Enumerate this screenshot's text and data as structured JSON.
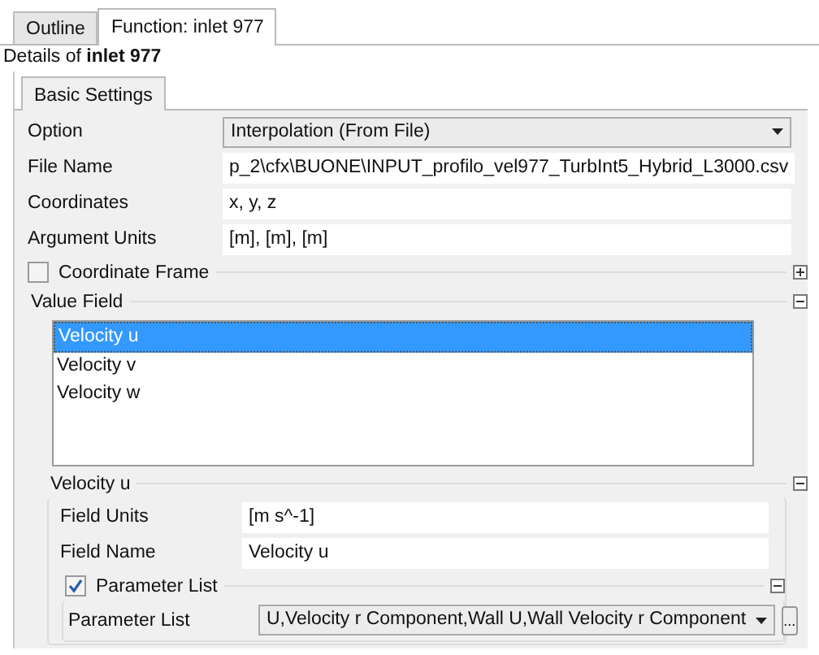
{
  "tabs": [
    {
      "label": "Outline",
      "selected": false
    },
    {
      "label": "Function: inlet 977",
      "selected": true
    }
  ],
  "details": "Details of **inlet 977**",
  "subtabs": [
    {
      "label": "Basic Settings",
      "selected": true
    }
  ],
  "fields": [
    {
      "label": "Option",
      "kind": "dropdown",
      "value": "Interpolation (From File)"
    },
    {
      "label": "File Name",
      "kind": "text",
      "value": "p_2\\cfx\\BUONE\\INPUT_profilo_vel977_TurbInt5_Hybrid_L3000.csv"
    },
    {
      "label": "Coordinates",
      "kind": "text",
      "value": "x, y, z"
    },
    {
      "label": "Argument Units",
      "kind": "text",
      "value": "[m], [m], [m]"
    }
  ],
  "coordinate_frame": {
    "label": "Coordinate Frame",
    "checked": false,
    "expanded": false
  },
  "value_field": {
    "label": "Value Field",
    "expanded": true,
    "items": [
      {
        "label": "Velocity u",
        "selected": true
      },
      {
        "label": "Velocity v",
        "selected": false
      },
      {
        "label": "Velocity w",
        "selected": false
      }
    ],
    "group": {
      "label": "Velocity u",
      "expanded": true,
      "fields": [
        {
          "label": "Field Units",
          "kind": "text",
          "value": "[m s^-1]"
        },
        {
          "label": "Field Name",
          "kind": "text",
          "value": "Velocity u"
        }
      ],
      "parameter_list": {
        "label": "Parameter List",
        "checked": true,
        "expanded": true,
        "fields": [
          {
            "label": "Parameter List",
            "kind": "dropdown",
            "value": "U,Velocity r Component,Wall U,Wall Velocity r Component",
            "browse": "..."
          }
        ]
      }
    }
  }
}
